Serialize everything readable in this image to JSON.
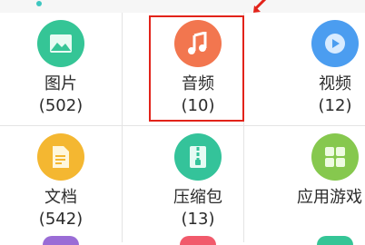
{
  "categories": [
    {
      "name": "图片",
      "count": "(502)",
      "icon": "image-icon",
      "color": "#35c596"
    },
    {
      "name": "音频",
      "count": "(10)",
      "icon": "music-note-icon",
      "color": "#f2764f"
    },
    {
      "name": "视频",
      "count": "(12)",
      "icon": "play-icon",
      "color": "#4b9df0"
    },
    {
      "name": "文档",
      "count": "(542)",
      "icon": "document-icon",
      "color": "#f4b731"
    },
    {
      "name": "压缩包",
      "count": "(13)",
      "icon": "zip-icon",
      "color": "#34c39a"
    },
    {
      "name": "应用游戏",
      "count": "",
      "icon": "apps-grid-icon",
      "color": "#86c84e"
    }
  ],
  "highlight_color": "#e2231a"
}
